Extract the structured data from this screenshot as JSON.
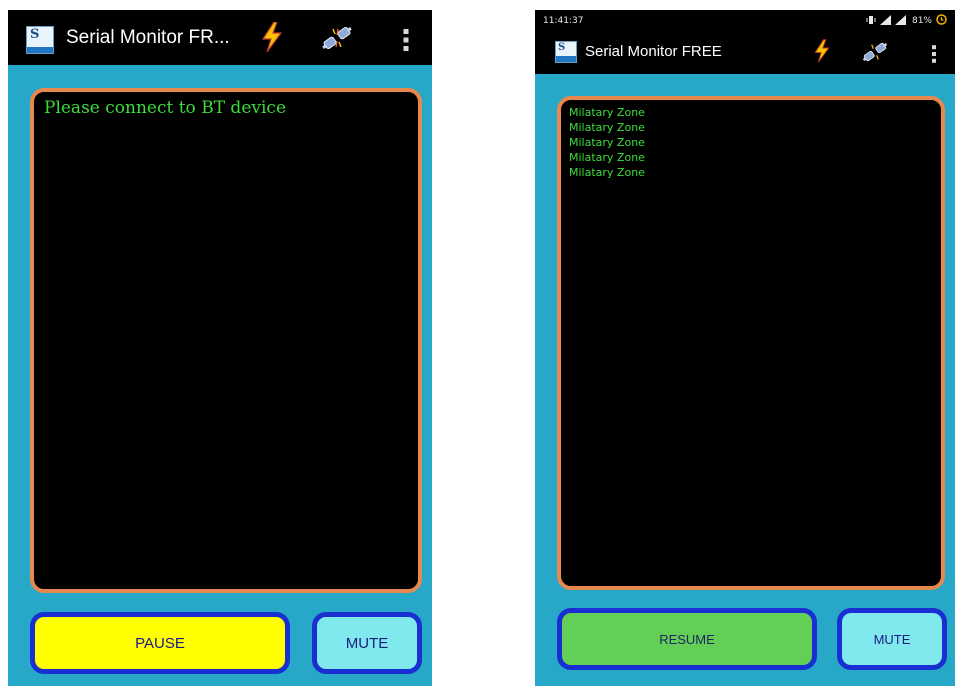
{
  "left": {
    "app_title": "Serial Monitor FR...",
    "terminal_message": "Please connect to BT device",
    "buttons": {
      "pause": "PAUSE",
      "mute": "MUTE"
    },
    "icons": [
      "app-logo-icon",
      "lightning-icon",
      "plug-icon",
      "overflow-menu-icon"
    ]
  },
  "right": {
    "status_bar": {
      "time": "11:41:37",
      "battery": "81%"
    },
    "app_title": "Serial Monitor FREE",
    "terminal_lines": [
      "Milatary Zone",
      "Milatary Zone",
      "Milatary Zone",
      "Milatary Zone",
      "Milatary Zone"
    ],
    "buttons": {
      "resume": "RESUME",
      "mute": "MUTE"
    },
    "icons": [
      "app-logo-icon",
      "lightning-icon",
      "plug-icon",
      "overflow-menu-icon",
      "vibrate-icon",
      "signal-icon",
      "battery-icon"
    ]
  },
  "colors": {
    "screen_bg": "#27a8c8",
    "terminal_border": "#e7884f",
    "terminal_text": "#3ddc3d",
    "button_border": "#1a2fd1",
    "pause_bg": "#ffff00",
    "resume_bg": "#64cf57",
    "mute_bg": "#7fe9ee"
  }
}
